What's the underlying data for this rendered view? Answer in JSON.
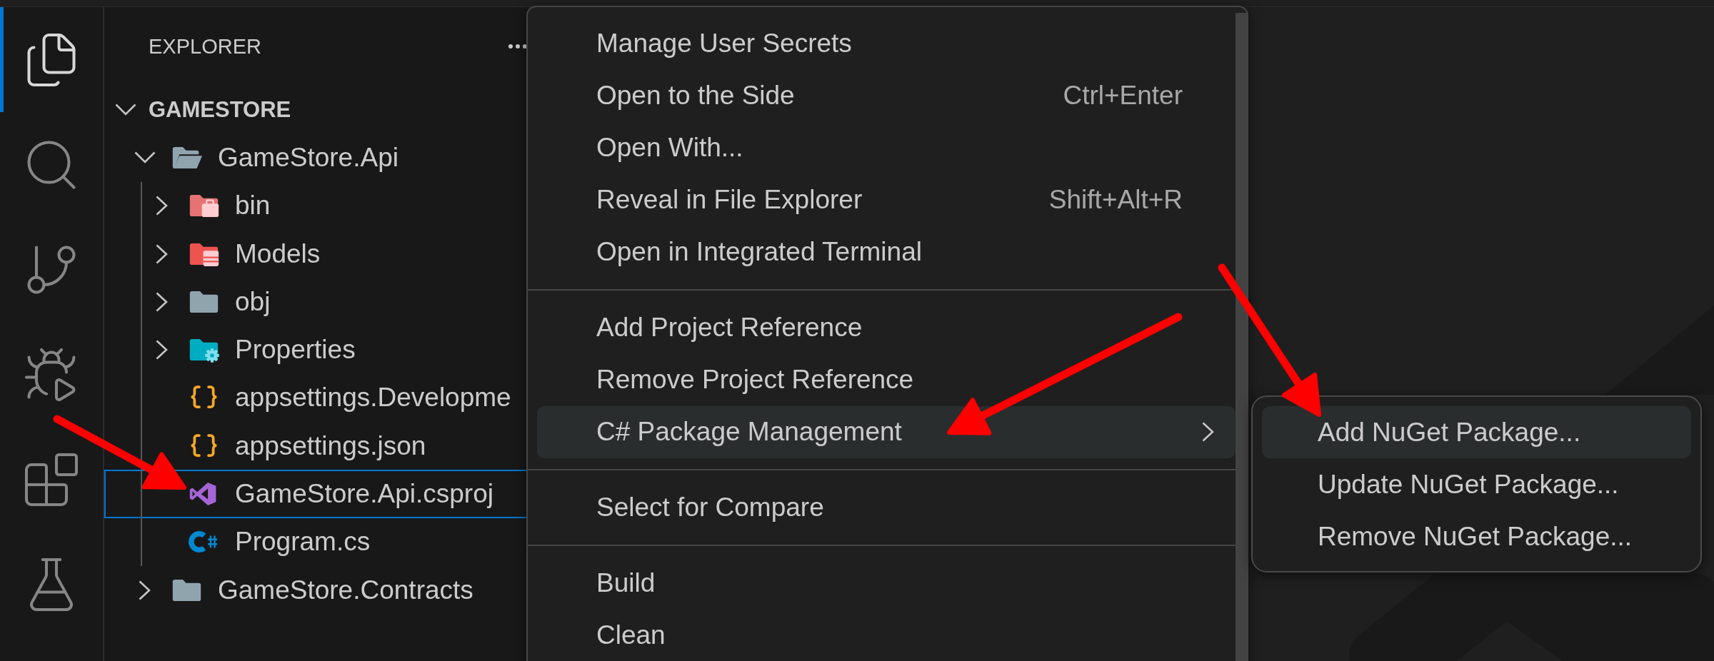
{
  "activity_bar": [
    {
      "kind": "explorer",
      "selected": true
    },
    {
      "kind": "search",
      "selected": false
    },
    {
      "kind": "scm",
      "selected": false
    },
    {
      "kind": "debug",
      "selected": false
    },
    {
      "kind": "extensions",
      "selected": false
    },
    {
      "kind": "testing",
      "selected": false
    }
  ],
  "explorer": {
    "title": "EXPLORER",
    "section": {
      "title": "GAMESTORE",
      "expanded": true
    },
    "tree": [
      {
        "name": "GameStore.Api",
        "kind": "folder",
        "expanded": true,
        "selected": false,
        "children": [
          {
            "name": "bin",
            "kind": "binfolder",
            "expanded": false,
            "selected": false
          },
          {
            "name": "Models",
            "kind": "modelsfolder",
            "expanded": false,
            "selected": false
          },
          {
            "name": "obj",
            "kind": "folder",
            "expanded": false,
            "selected": false
          },
          {
            "name": "Properties",
            "kind": "settingsfolder",
            "expanded": false,
            "selected": false
          },
          {
            "name": "appsettings.Developme",
            "kind": "json",
            "selected": false
          },
          {
            "name": "appsettings.json",
            "kind": "json",
            "selected": false
          },
          {
            "name": "GameStore.Api.csproj",
            "kind": "project",
            "selected": true
          },
          {
            "name": "Program.cs",
            "kind": "csharp",
            "selected": false
          }
        ]
      },
      {
        "name": "GameStore.Contracts",
        "kind": "folder",
        "expanded": false,
        "selected": false
      }
    ]
  },
  "context_menu": {
    "sections": [
      {
        "items": [
          {
            "label": "Manage User Secrets",
            "selected": false
          },
          {
            "label": "Open to the Side",
            "shortcut": "Ctrl+Enter",
            "selected": false
          },
          {
            "label": "Open With...",
            "selected": false
          },
          {
            "label": "Reveal in File Explorer",
            "shortcut": "Shift+Alt+R",
            "selected": false
          },
          {
            "label": "Open in Integrated Terminal",
            "selected": false
          }
        ]
      },
      {
        "items": [
          {
            "label": "Add Project Reference",
            "selected": false
          },
          {
            "label": "Remove Project Reference",
            "selected": false
          },
          {
            "label": "C# Package Management",
            "has_submenu": true,
            "selected": true
          }
        ]
      },
      {
        "items": [
          {
            "label": "Select for Compare",
            "selected": false
          }
        ]
      },
      {
        "items": [
          {
            "label": "Build",
            "selected": false
          },
          {
            "label": "Clean",
            "selected": false
          }
        ]
      }
    ]
  },
  "submenu": {
    "items": [
      {
        "label": "Add NuGet Package...",
        "selected": true
      },
      {
        "label": "Update NuGet Package...",
        "selected": false
      },
      {
        "label": "Remove NuGet Package...",
        "selected": false
      }
    ]
  }
}
